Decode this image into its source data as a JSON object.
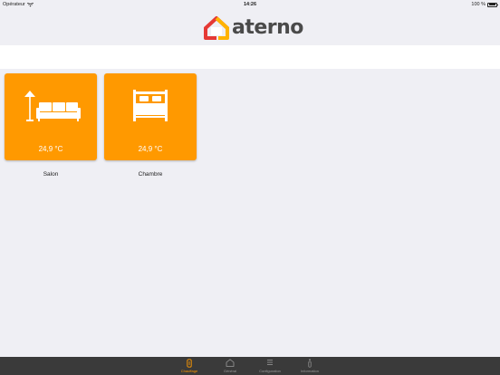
{
  "status_bar": {
    "carrier": "Opérateur",
    "time": "14:26",
    "battery": "100 %"
  },
  "header": {
    "logo_text": "aterno"
  },
  "rooms": [
    {
      "name": "Salon",
      "temperature": "24,9 °C",
      "icon": "sofa-lamp-icon"
    },
    {
      "name": "Chambre",
      "temperature": "24,9 °C",
      "icon": "bed-icon"
    }
  ],
  "tab_bar": {
    "active": 0,
    "tabs": [
      {
        "label": "Chauffage",
        "icon": "radiator-icon"
      },
      {
        "label": "Général",
        "icon": "house-icon"
      },
      {
        "label": "Configuration",
        "icon": "list-icon"
      },
      {
        "label": "Information",
        "icon": "info-icon"
      }
    ]
  },
  "colors": {
    "accent": "#ff9900",
    "logo_red": "#e53935",
    "logo_yellow": "#ffb300",
    "tab_bar": "#3a3a3a",
    "background": "#efeff4"
  }
}
